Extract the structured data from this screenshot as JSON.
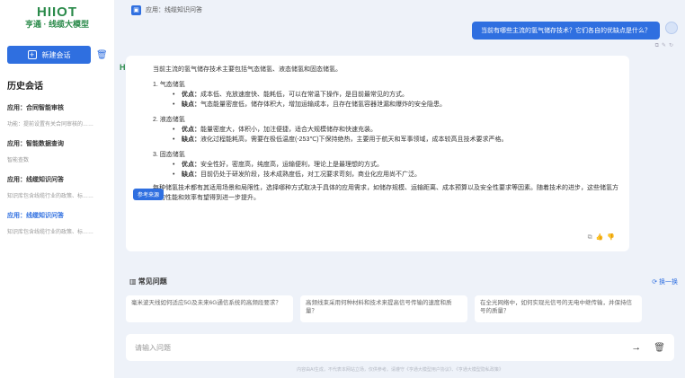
{
  "sidebar": {
    "logo_main": "HIIOT",
    "logo_sub": "亨通 · 线缆大模型",
    "new_chat_label": "新建会话",
    "history_title": "历史会话",
    "items": [
      {
        "name": "应用：合同智能审核",
        "desc": "功能：提前设置有关合同审核的……"
      },
      {
        "name": "应用：智能数据查询",
        "desc": "智能查数"
      },
      {
        "name": "应用：线缆知识问答",
        "desc": "知识库包含线缆行业的政策、标……"
      },
      {
        "name": "应用：线缆知识问答",
        "desc": "知识库包含线缆行业的政策、标……"
      }
    ]
  },
  "topbar": {
    "app_label": "应用：线缆知识问答"
  },
  "user_message": "当前有哪些主流的氢气储存技术？它们各自的优缺点是什么？",
  "answer": {
    "intro": "当前主流的氢气储存技术主要包括气态储氢、液态储氢和固态储氢。",
    "sections": [
      {
        "title": "1. 气态储氢",
        "pros_label": "优点：",
        "pros": "成本低、充放速度快、能耗低，可以在常温下操作，是目前最常见的方式。",
        "cons_label": "缺点：",
        "cons": "气态能量密度低，储存体积大，增加运输成本，且存在储氢容器泄漏和爆炸的安全隐患。"
      },
      {
        "title": "2. 液态储氢",
        "pros_label": "优点：",
        "pros": "能量密度大，体积小，加注便捷，适合大规模储存和快速充装。",
        "cons_label": "缺点：",
        "cons": "液化过程能耗高，需要在极低温度(-253℃)下保持绝热，主要用于航天和军事领域，成本较高且技术要求严格。"
      },
      {
        "title": "3. 固态储氢",
        "pros_label": "优点：",
        "pros": "安全性好，密度高，纯度高，运输便利，理论上是最理想的方式。",
        "cons_label": "缺点：",
        "cons": "目前仍处于研发阶段，技术成熟度低，对工况要求苛刻，商业化应用尚不广泛。"
      }
    ],
    "summary": "每种储氢技术都有其适用场景和局限性，选择哪种方式取决于具体的应用需求，如储存规模、运输距离、成本预算以及安全性要求等因素。随着技术的进步，这些储氢方式的性能和效率有望得到进一步提升。",
    "ref_button": "参考来源"
  },
  "faq": {
    "title": "常见问题",
    "refresh_label": "换一换",
    "questions": [
      "毫米波天线如何适应5G及未来6G通信系统的高频段要求？",
      "高频线束采用何种材料和技术来提高信号传输的速度和质量？",
      "在全光网络中，如何实现光信号的无电中继传输，并保持信号的质量？"
    ]
  },
  "input": {
    "placeholder": "请输入问题"
  },
  "footer_note": "内容由AI生成，不代表本网站立场，仅供参考。请遵守《亨通大模型用户协议》、《亨通大模型隐私政策》"
}
